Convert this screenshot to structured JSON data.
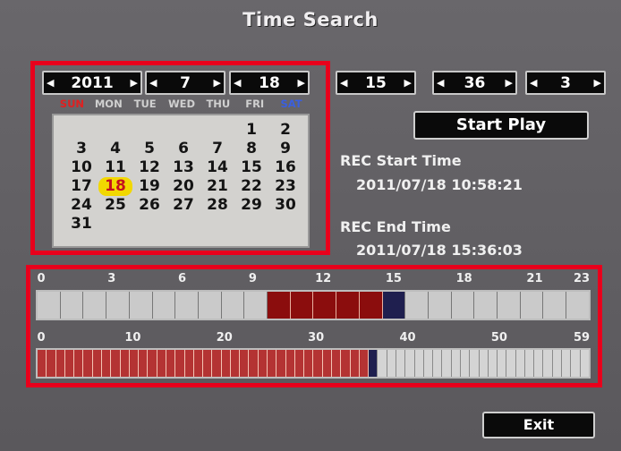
{
  "title": "Time Search",
  "date_spinners": {
    "year": "2011",
    "month": "7",
    "day": "18"
  },
  "time_spinners": {
    "hour": "15",
    "minute": "36",
    "second": "3"
  },
  "calendar": {
    "weekdays": [
      "SUN",
      "MON",
      "TUE",
      "WED",
      "THU",
      "FRI",
      "SAT"
    ],
    "weeks": [
      [
        "",
        "",
        "",
        "",
        "",
        "1",
        "2"
      ],
      [
        "3",
        "4",
        "5",
        "6",
        "7",
        "8",
        "9"
      ],
      [
        "10",
        "11",
        "12",
        "13",
        "14",
        "15",
        "16"
      ],
      [
        "17",
        "18",
        "19",
        "20",
        "21",
        "22",
        "23"
      ],
      [
        "24",
        "25",
        "26",
        "27",
        "28",
        "29",
        "30"
      ],
      [
        "31",
        "",
        "",
        "",
        "",
        "",
        ""
      ]
    ],
    "selected_day": "18"
  },
  "start_play_label": "Start Play",
  "rec_start_label": "REC Start Time",
  "rec_start_value": "2011/07/18 10:58:21",
  "rec_end_label": "REC End Time",
  "rec_end_value": "2011/07/18 15:36:03",
  "hour_axis": [
    "0",
    "3",
    "6",
    "9",
    "12",
    "15",
    "18",
    "21",
    "23"
  ],
  "hour_recorded_range": [
    10,
    14
  ],
  "hour_current": 15,
  "minute_axis": [
    "0",
    "10",
    "20",
    "30",
    "40",
    "50",
    "59"
  ],
  "minute_recorded_range": [
    0,
    35
  ],
  "minute_current": 36,
  "exit_label": "Exit",
  "colors": {
    "highlight_box": "#e8001c",
    "recorded": "#8b0d0d",
    "selected_day": "#f2d800",
    "saturday": "#3a5fe0",
    "sunday": "#e02020"
  }
}
